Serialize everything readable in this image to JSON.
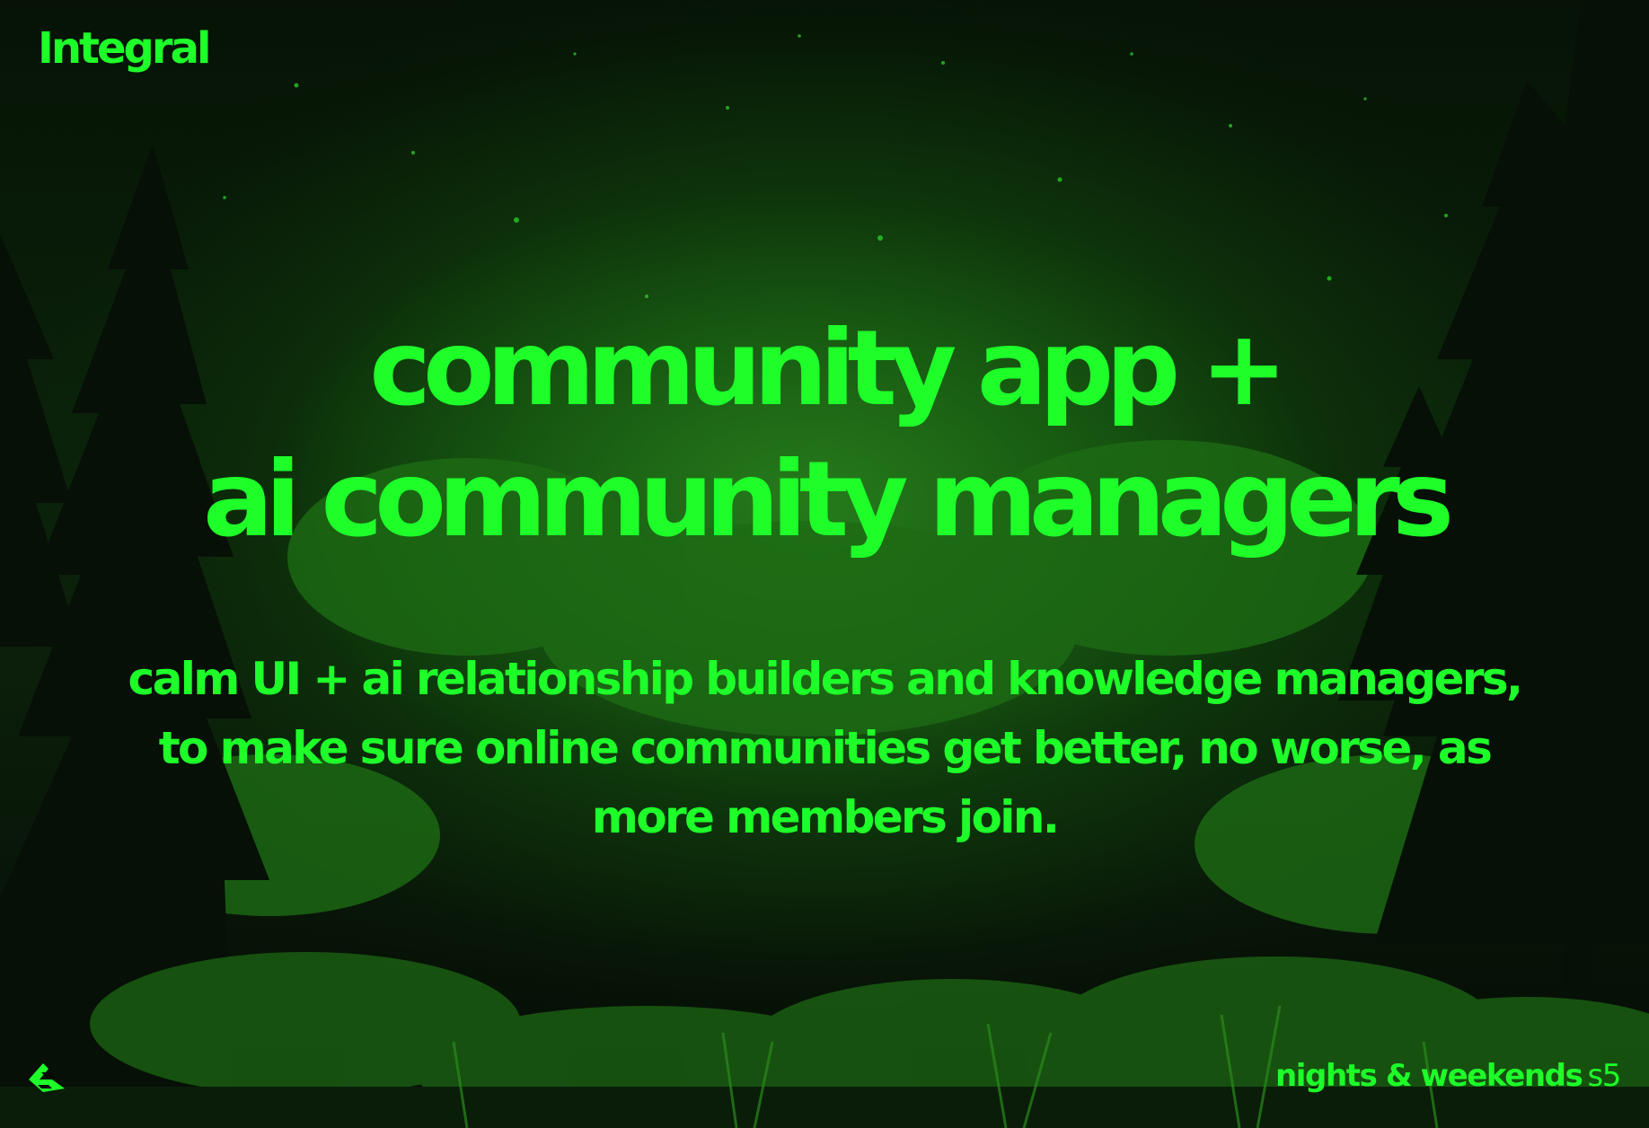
{
  "brand": {
    "name": "Integral"
  },
  "headline": {
    "line1": "community app +",
    "line2": "ai community managers"
  },
  "tagline": {
    "line1": "calm UI + ai relationship builders and knowledge managers,",
    "line2": "to make sure online communities get better, no worse, as",
    "line3": "more members join."
  },
  "footer": {
    "program_name": "nights & weekends",
    "season": "s5"
  },
  "icons": {
    "corner_logo": "buildspace-logo-icon"
  },
  "colors": {
    "accent": "#1eff2a",
    "background": "#050805",
    "forest_glow": "#1f6a17"
  }
}
